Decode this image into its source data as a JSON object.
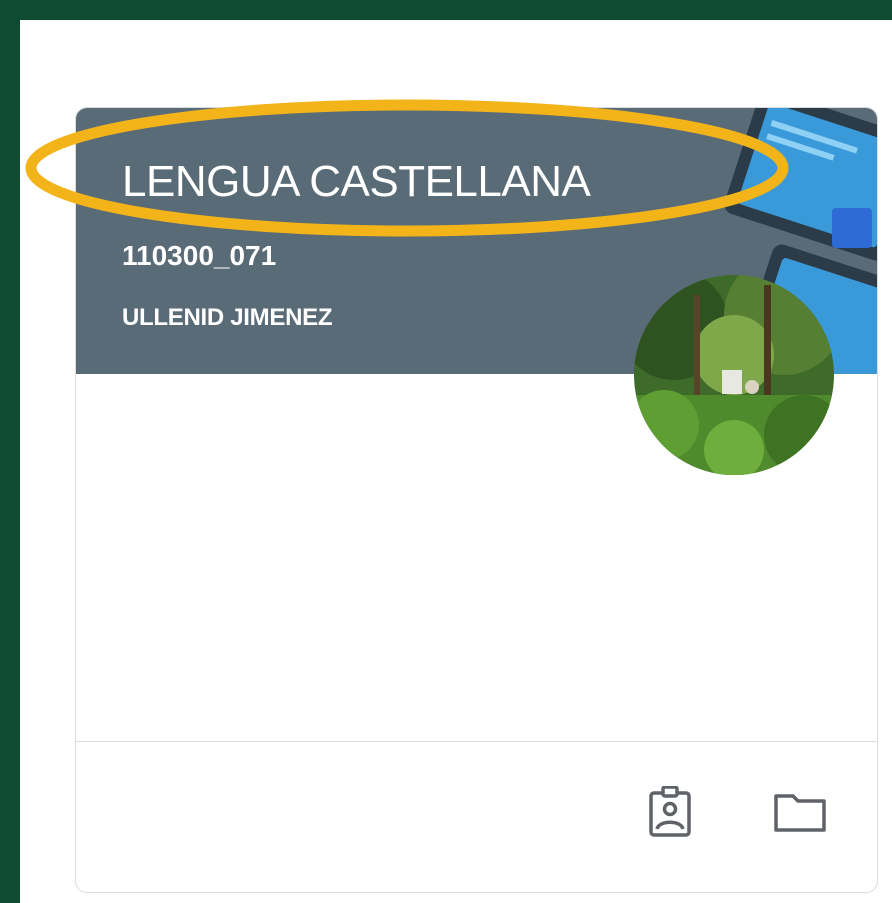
{
  "class_card": {
    "title": "LENGUA CASTELLANA",
    "section": "110300_071",
    "teacher": "ULLENID JIMENEZ",
    "banner_color": "#5a6b78",
    "footer_icons": [
      "assignment-ind-icon",
      "folder-icon"
    ]
  },
  "annotation": {
    "highlight_color": "#f2b418"
  },
  "background_color": "#0f4a33"
}
